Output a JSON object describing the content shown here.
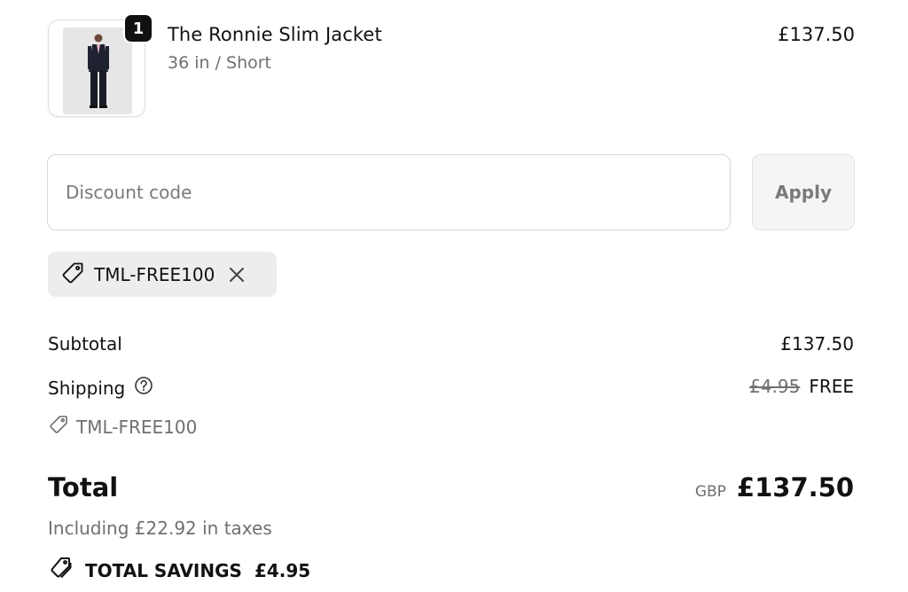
{
  "product": {
    "name": "The Ronnie Slim Jacket",
    "variant": "36 in / Short",
    "price": "£137.50",
    "quantity": "1",
    "image_icon": "suit-model-photo"
  },
  "discount": {
    "placeholder": "Discount code",
    "apply_label": "Apply",
    "applied_code": "TML-FREE100"
  },
  "summary": {
    "subtotal_label": "Subtotal",
    "subtotal_value": "£137.50",
    "shipping_label": "Shipping",
    "shipping_original": "£4.95",
    "shipping_value": "FREE",
    "shipping_discount_code": "TML-FREE100",
    "total_label": "Total",
    "currency": "GBP",
    "total_value": "£137.50",
    "tax_note": "Including £22.92 in taxes",
    "savings_label": "TOTAL SAVINGS",
    "savings_value": "£4.95"
  },
  "colors": {
    "text": "#111111",
    "muted": "#707070",
    "chip_bg": "#ededed",
    "badge_bg": "#111111"
  }
}
